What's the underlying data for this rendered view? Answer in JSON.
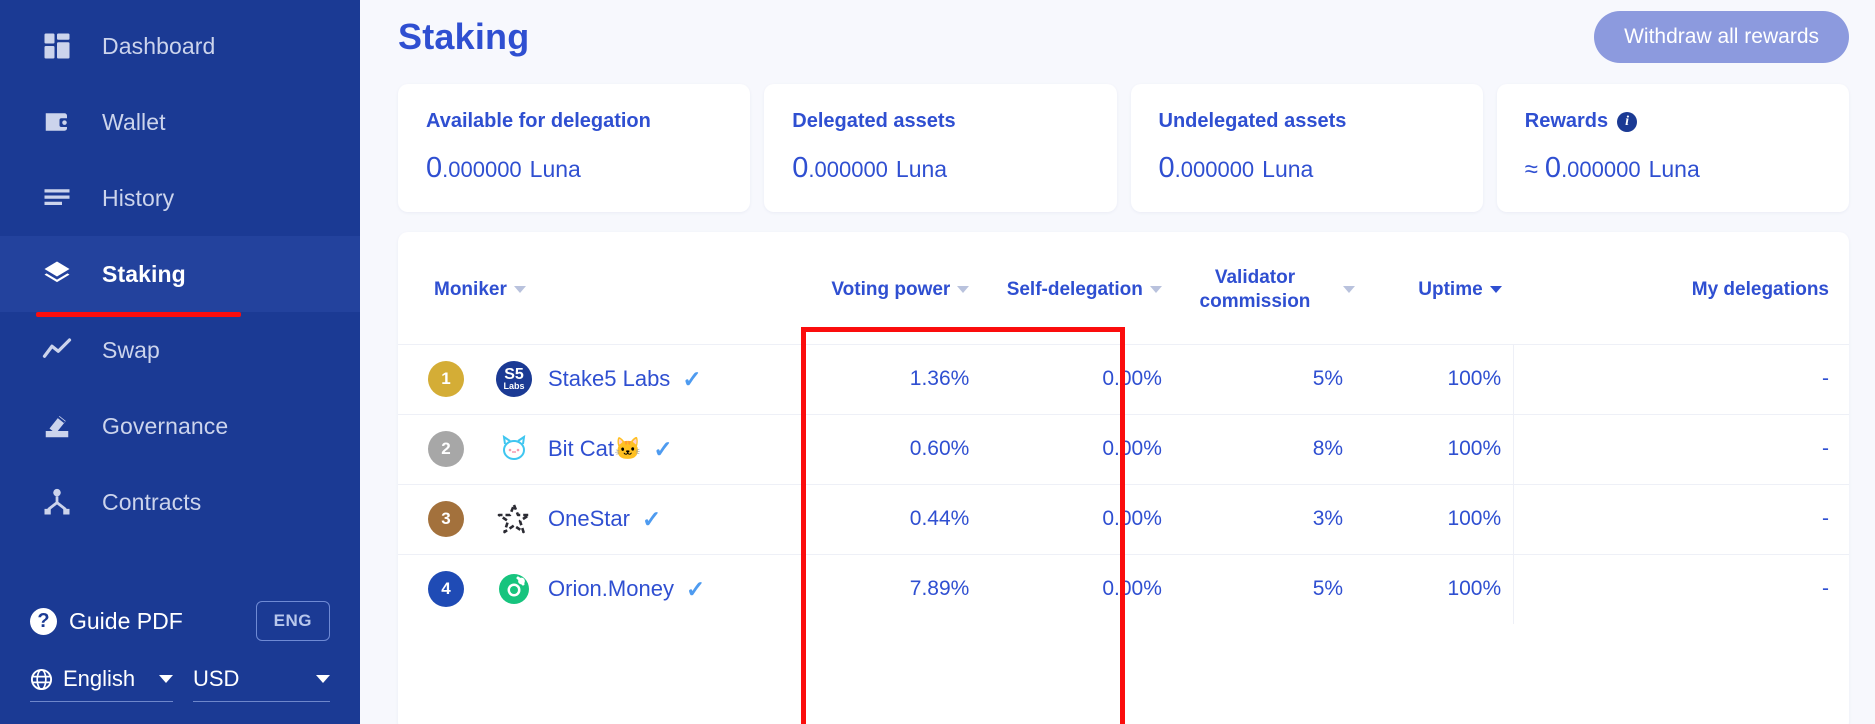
{
  "sidebar": {
    "items": [
      {
        "label": "Dashboard",
        "icon": "dashboard-grid-icon",
        "active": false
      },
      {
        "label": "Wallet",
        "icon": "wallet-icon",
        "active": false
      },
      {
        "label": "History",
        "icon": "history-lines-icon",
        "active": false
      },
      {
        "label": "Staking",
        "icon": "staking-layers-icon",
        "active": true
      },
      {
        "label": "Swap",
        "icon": "swap-chart-icon",
        "active": false
      },
      {
        "label": "Governance",
        "icon": "governance-ballot-icon",
        "active": false
      },
      {
        "label": "Contracts",
        "icon": "contracts-node-icon",
        "active": false
      }
    ],
    "guide_label": "Guide PDF",
    "guide_icon": "question-circle-icon",
    "language_badge": "ENG",
    "language_select": "English",
    "language_icon": "globe-icon",
    "currency_select": "USD",
    "accent_navy": "#1b3a94",
    "annotation_underline_color": "#fb0d0d"
  },
  "header": {
    "title": "Staking",
    "withdraw_button": "Withdraw all rewards",
    "withdraw_button_color": "#8c9ade",
    "title_color": "#2f4fd1"
  },
  "stats": [
    {
      "label": "Available for delegation",
      "approx": "",
      "whole": "0",
      "frac": ".000000",
      "unit": "Luna",
      "info": false
    },
    {
      "label": "Delegated assets",
      "approx": "",
      "whole": "0",
      "frac": ".000000",
      "unit": "Luna",
      "info": false
    },
    {
      "label": "Undelegated assets",
      "approx": "",
      "whole": "0",
      "frac": ".000000",
      "unit": "Luna",
      "info": false
    },
    {
      "label": "Rewards",
      "approx": "≈",
      "whole": "0",
      "frac": ".000000",
      "unit": "Luna",
      "info": true
    }
  ],
  "table": {
    "columns": [
      {
        "label": "Moniker",
        "sortable": true,
        "sort_active": false,
        "align": "left"
      },
      {
        "label": "Voting power",
        "sortable": true,
        "sort_active": false,
        "align": "right"
      },
      {
        "label": "Self-delegation",
        "sortable": true,
        "sort_active": false,
        "align": "right"
      },
      {
        "label": "Validator commission",
        "sortable": true,
        "sort_active": false,
        "align": "center"
      },
      {
        "label": "Uptime",
        "sortable": true,
        "sort_active": true,
        "align": "right"
      },
      {
        "label": "My delegations",
        "sortable": false,
        "sort_active": false,
        "align": "right"
      }
    ],
    "rows": [
      {
        "rank": "1",
        "rank_color": "#d4ad36",
        "avatar": "stake5-labs-logo",
        "avatar_bg": "#1b3a94",
        "name": "Stake5 Labs",
        "verified": true,
        "voting_power": "1.36%",
        "self_delegation": "0.00%",
        "commission": "5%",
        "uptime": "100%",
        "my_delegations": "-"
      },
      {
        "rank": "2",
        "rank_color": "#a7a7a7",
        "avatar": "bit-cat-logo",
        "avatar_bg": "#ffffff",
        "name": "Bit Cat🐱",
        "verified": true,
        "voting_power": "0.60%",
        "self_delegation": "0.00%",
        "commission": "8%",
        "uptime": "100%",
        "my_delegations": "-"
      },
      {
        "rank": "3",
        "rank_color": "#a3713c",
        "avatar": "onestar-logo",
        "avatar_bg": "#ffffff",
        "name": "OneStar",
        "verified": true,
        "voting_power": "0.44%",
        "self_delegation": "0.00%",
        "commission": "3%",
        "uptime": "100%",
        "my_delegations": "-"
      },
      {
        "rank": "4",
        "rank_color": "#1f4bb5",
        "avatar": "orion-money-logo",
        "avatar_bg": "#ffffff",
        "name": "Orion.Money",
        "verified": true,
        "voting_power": "7.89%",
        "self_delegation": "0.00%",
        "commission": "5%",
        "uptime": "100%",
        "my_delegations": "-"
      }
    ],
    "verified_mark": "✓"
  }
}
